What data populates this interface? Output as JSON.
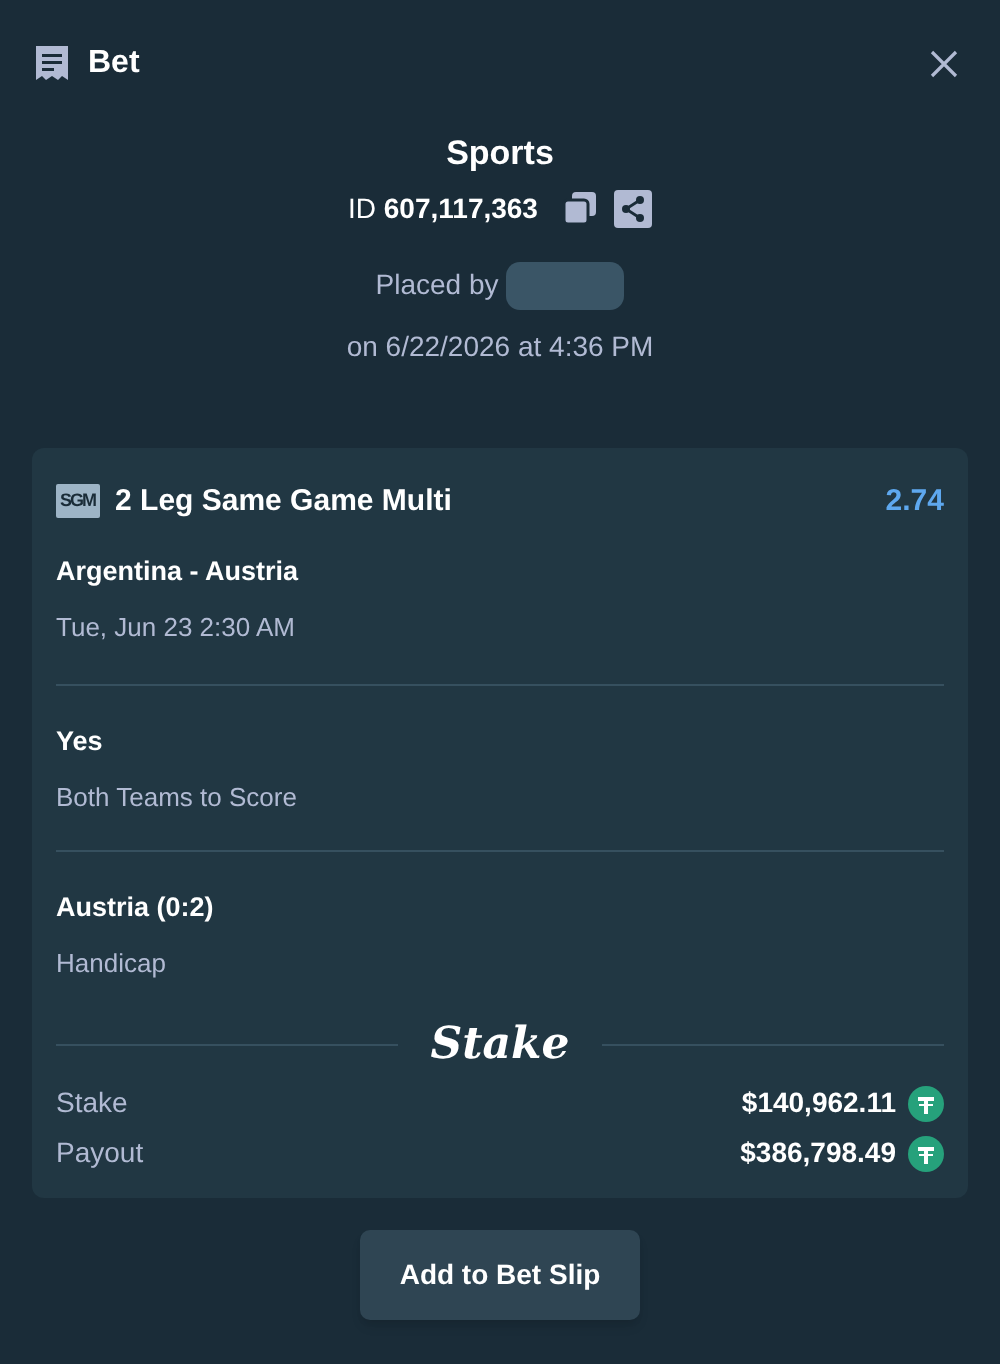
{
  "header": {
    "title": "Bet"
  },
  "summary": {
    "category": "Sports",
    "id_label": "ID",
    "id_value": "607,117,363",
    "placed_by": "Placed by",
    "placed_on": "on 6/22/2026 at 4:36 PM"
  },
  "bet": {
    "badge": "SGM",
    "title": "2 Leg Same Game Multi",
    "odds": "2.74",
    "legs": [
      {
        "title": "Argentina - Austria",
        "subtitle": "Tue, Jun 23 2:30 AM"
      },
      {
        "title": "Yes",
        "subtitle": "Both Teams to Score"
      },
      {
        "title": "Austria (0:2)",
        "subtitle": "Handicap"
      }
    ],
    "logo": "Stake",
    "totals": [
      {
        "label": "Stake",
        "value": "$140,962.11"
      },
      {
        "label": "Payout",
        "value": "$386,798.49"
      }
    ]
  },
  "button": "Add to Bet Slip"
}
